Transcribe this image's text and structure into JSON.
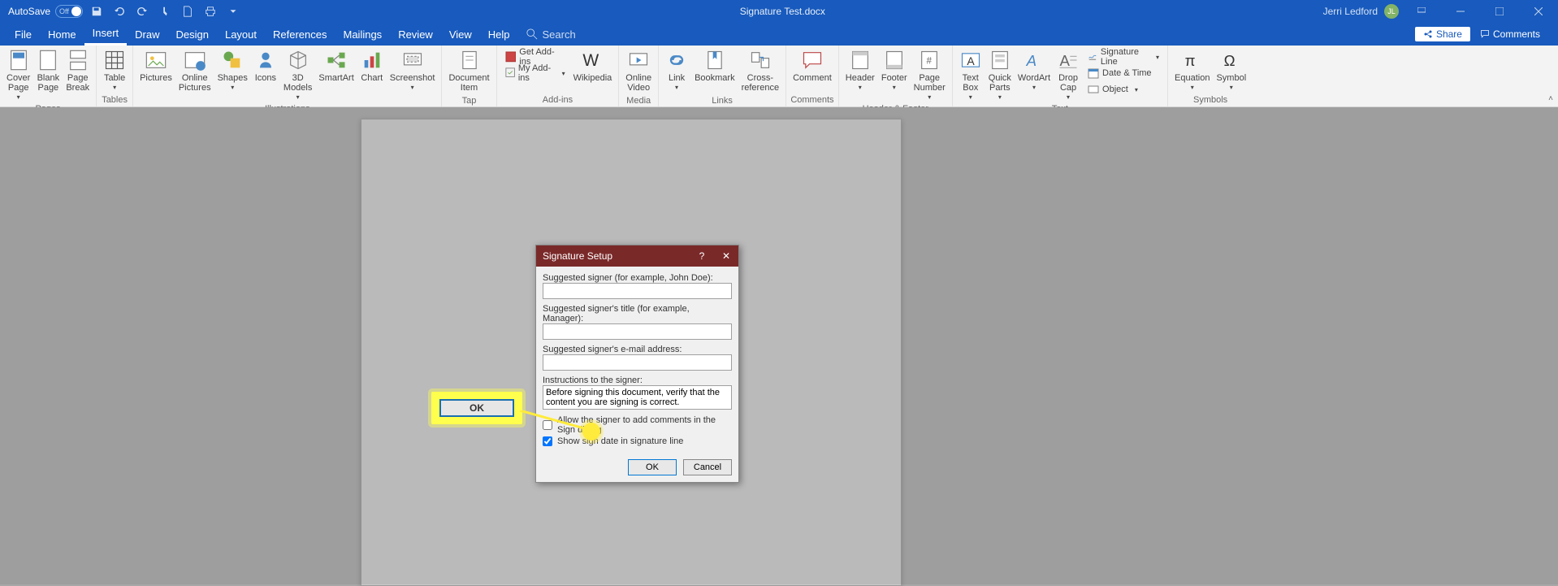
{
  "titlebar": {
    "autosave_label": "AutoSave",
    "autosave_state": "Off",
    "document_title": "Signature Test.docx",
    "user_name": "Jerri Ledford",
    "user_initials": "JL"
  },
  "menubar": {
    "tabs": [
      "File",
      "Home",
      "Insert",
      "Draw",
      "Design",
      "Layout",
      "References",
      "Mailings",
      "Review",
      "View",
      "Help"
    ],
    "active_tab_index": 2,
    "search_placeholder": "Search",
    "share_label": "Share",
    "comments_label": "Comments"
  },
  "ribbon": {
    "groups": {
      "pages": {
        "label": "Pages",
        "cover_page": "Cover\nPage",
        "blank_page": "Blank\nPage",
        "page_break": "Page\nBreak"
      },
      "tables": {
        "label": "Tables",
        "table": "Table"
      },
      "illustrations": {
        "label": "Illustrations",
        "pictures": "Pictures",
        "online_pictures": "Online\nPictures",
        "shapes": "Shapes",
        "icons": "Icons",
        "models3d": "3D\nModels",
        "smartart": "SmartArt",
        "chart": "Chart",
        "screenshot": "Screenshot"
      },
      "tap": {
        "label": "Tap",
        "document_item": "Document\nItem"
      },
      "addins": {
        "label": "Add-ins",
        "get_addins": "Get Add-ins",
        "my_addins": "My Add-ins",
        "wikipedia": "Wikipedia"
      },
      "media": {
        "label": "Media",
        "online_video": "Online\nVideo"
      },
      "links": {
        "label": "Links",
        "link": "Link",
        "bookmark": "Bookmark",
        "cross_reference": "Cross-\nreference"
      },
      "comments": {
        "label": "Comments",
        "comment": "Comment"
      },
      "headerfooter": {
        "label": "Header & Footer",
        "header": "Header",
        "footer": "Footer",
        "page_number": "Page\nNumber"
      },
      "text": {
        "label": "Text",
        "text_box": "Text\nBox",
        "quick_parts": "Quick\nParts",
        "wordart": "WordArt",
        "drop_cap": "Drop\nCap",
        "signature_line": "Signature Line",
        "date_time": "Date & Time",
        "object": "Object"
      },
      "symbols": {
        "label": "Symbols",
        "equation": "Equation",
        "symbol": "Symbol"
      }
    }
  },
  "dialog": {
    "title": "Signature Setup",
    "help": "?",
    "close": "✕",
    "suggested_signer_label": "Suggested signer (for example, John Doe):",
    "suggested_signer_value": "",
    "signer_title_label": "Suggested signer's title (for example, Manager):",
    "signer_title_value": "",
    "signer_email_label": "Suggested signer's e-mail address:",
    "signer_email_value": "",
    "instructions_label": "Instructions to the signer:",
    "instructions_value": "Before signing this document, verify that the content you are signing is correct.",
    "allow_comments_label": "Allow the signer to add comments in the Sign dialog",
    "allow_comments_checked": false,
    "show_date_label": "Show sign date in signature line",
    "show_date_checked": true,
    "ok_label": "OK",
    "cancel_label": "Cancel"
  },
  "callout": {
    "label": "OK"
  }
}
